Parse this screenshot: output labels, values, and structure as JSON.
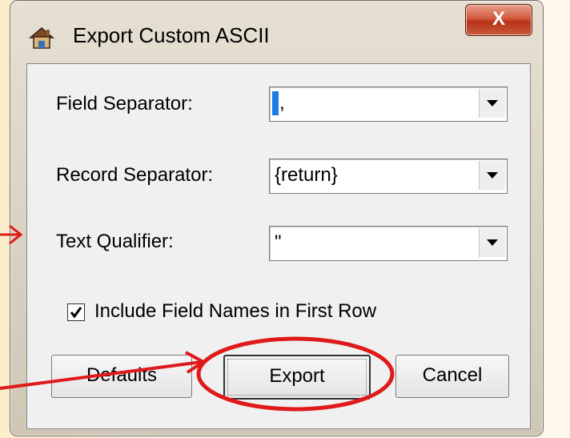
{
  "window": {
    "title": "Export Custom ASCII",
    "close_label": "X"
  },
  "form": {
    "field_separator": {
      "label": "Field Separator:",
      "value": ","
    },
    "record_separator": {
      "label": "Record Separator:",
      "value": "{return}"
    },
    "text_qualifier": {
      "label": "Text Qualifier:",
      "value": "\""
    },
    "include_field_names": {
      "label": "Include Field Names in First Row",
      "checked": true
    }
  },
  "buttons": {
    "defaults": "Defaults",
    "export": "Export",
    "cancel": "Cancel"
  },
  "annotation": {
    "highlight_color": "#e0191a"
  }
}
